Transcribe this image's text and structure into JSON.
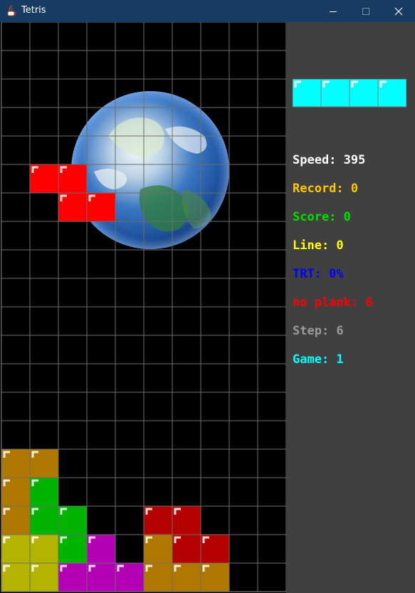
{
  "window": {
    "title": "Tetris",
    "controls": [
      "minimize-icon",
      "maximize-icon",
      "close-icon"
    ]
  },
  "board": {
    "columns": 10,
    "rows": 20,
    "background": "earth-globe-image",
    "colors": {
      "R": "#ff0000",
      "D": "#b50000",
      "O": "#b07800",
      "G": "#00b400",
      "Y": "#b4b400",
      "M": "#b400b4",
      "C": "#00ffff"
    },
    "falling_piece": {
      "shape": "Z",
      "color": "R",
      "cells": [
        [
          5,
          3
        ],
        [
          5,
          4
        ],
        [
          6,
          4
        ],
        [
          6,
          5
        ]
      ]
    },
    "locked_rows": [
      "OO........",
      "OG........",
      "OGG..DD...",
      "YYGM.ODD..",
      "YYMMMOOO.."
    ]
  },
  "next_piece": {
    "shape": "I",
    "color": "C",
    "cells": 4
  },
  "stats": [
    {
      "label": "Speed: 395",
      "color": "#ffffff"
    },
    {
      "label": "Record: 0",
      "color": "#ffc800"
    },
    {
      "label": "Score: 0",
      "color": "#00e000"
    },
    {
      "label": "Line: 0",
      "color": "#ffff00"
    },
    {
      "label": "TRT: 0%",
      "color": "#0000ff"
    },
    {
      "label": "no plank: 6",
      "color": "#ff0000"
    },
    {
      "label": "Step: 6",
      "color": "#9a9a9a"
    },
    {
      "label": "Game: 1",
      "color": "#00ffff"
    }
  ]
}
